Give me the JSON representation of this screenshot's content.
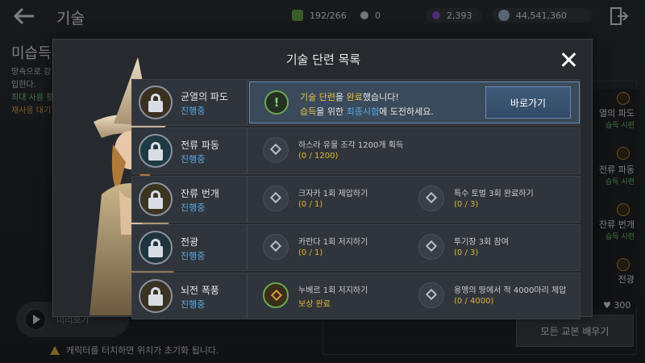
{
  "header": {
    "title": "기술",
    "resources": [
      {
        "name": "energy",
        "value": "192/266",
        "color": "#6aa84f"
      },
      {
        "name": "pearl",
        "value": "0",
        "color": "#d8d8d8"
      },
      {
        "name": "black-gem",
        "value": "2,393",
        "color": "#8a4fd8"
      },
      {
        "name": "silver",
        "value": "44,541,360",
        "color": "#9fb6d6"
      }
    ]
  },
  "background": {
    "skill_title": "미습득",
    "desc_line1": "땅속으로 강",
    "desc_line2": "입한다.",
    "max_use": "최대 사용 횟",
    "cooldown": "재사용 대기",
    "preview_label": "미리보기",
    "warning": "캐릭터를 터치하면 위치가 초기화 됩니다.",
    "learn_all": "모든 교본 배우기",
    "count": "300",
    "right_items": [
      {
        "name": "열의 파도",
        "status": "습득 시련"
      },
      {
        "name": "전류 파동",
        "status": "습득 시련"
      },
      {
        "name": "잔류 번개",
        "status": "습득 시련"
      },
      {
        "name": "전광",
        "status": ""
      }
    ]
  },
  "modal": {
    "title": "기술 단련 목록",
    "rows": [
      {
        "name": "균열의 파도",
        "status": "진행중",
        "notice": {
          "line1_prefix": "기술 단련",
          "line1_mid": "을 ",
          "line1_hl": "완료",
          "line1_suffix": "했습니다!",
          "line2_prefix": "습득",
          "line2_mid": "을 위한 ",
          "line2_hl": "최종시험",
          "line2_suffix": "에 도전하세요.",
          "button": "바로가기"
        }
      },
      {
        "name": "전류 파동",
        "status": "진행중",
        "quests": [
          {
            "text": "하스라 유물 조각 1200개 획득",
            "progress": "(0 / 1200)"
          }
        ]
      },
      {
        "name": "잔류 번개",
        "status": "진행중",
        "quests": [
          {
            "text": "크자카 1회 제압하기",
            "progress": "(0 / 1)"
          },
          {
            "text": "특수 토벌 3회 완료하기",
            "progress": "(0 / 3)"
          }
        ]
      },
      {
        "name": "전광",
        "status": "진행중",
        "quests": [
          {
            "text": "카란다 1회 저지하기",
            "progress": "(0 / 1)"
          },
          {
            "text": "투기장 3회 참여",
            "progress": "(0 / 3)"
          }
        ]
      },
      {
        "name": "뇌전 폭풍",
        "status": "진행중",
        "quests": [
          {
            "text": "누베르 1회 저지하기",
            "progress": "보상 완료",
            "done": true
          },
          {
            "text": "용맹의 땅에서 적 4000마리 제압",
            "progress": "(0 / 4000)"
          }
        ]
      }
    ]
  }
}
